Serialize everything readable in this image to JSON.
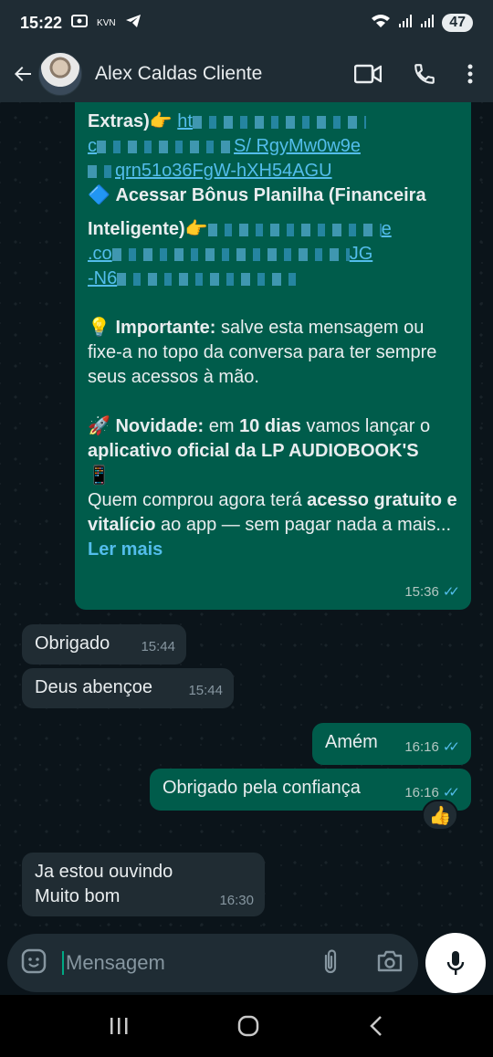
{
  "status_bar": {
    "time": "15:22",
    "kvn": "KVN",
    "battery": "47"
  },
  "header": {
    "contact_name": "Alex Caldas Cliente"
  },
  "messages": {
    "big": {
      "line1_bold": "Extras)👉",
      "line1_link": "ht",
      "line2_link": "c",
      "line2_link_end": "S/ RgyMw0w9e",
      "line3_link": "qrn51o36FgW-hXH54AGU",
      "bonus_icon": "🔷",
      "bonus_bold": "Acessar Bônus Planilha (Financeira",
      "bonus_bold2": "Inteligente)👉",
      "bonus_link_end": "e",
      "link_c": ".co",
      "link_c_end": "JG",
      "link_n": "-N6",
      "important_icon": "💡",
      "important_bold": "Importante:",
      "important_text": " salve esta mensagem ou fixe-a no topo da conversa para ter sempre seus acessos à mão.",
      "news_icon": "🚀",
      "news_bold": "Novidade:",
      "news_text1": " em ",
      "news_bold2": "10 dias",
      "news_text2": " vamos lançar o ",
      "news_bold3": "aplicativo oficial da LP AUDIOBOOK'S",
      "phone_icon": "📱",
      "who_text1": "Quem comprou agora terá ",
      "who_bold": "acesso gratuito e vitalício",
      "who_text2": " ao app — sem pagar nada a mais...",
      "read_more": "Ler mais",
      "time": "15:36"
    },
    "m1": {
      "text": "Obrigado",
      "time": "15:44"
    },
    "m2": {
      "text": "Deus abençoe",
      "time": "15:44"
    },
    "m3": {
      "text": "Amém",
      "time": "16:16"
    },
    "m4": {
      "text": "Obrigado pela confiança",
      "time": "16:16",
      "reaction": "👍"
    },
    "m5": {
      "line1": "Ja estou ouvindo",
      "line2": "Muito bom",
      "time": "16:30"
    }
  },
  "input": {
    "placeholder": "Mensagem"
  },
  "colors": {
    "outgoing": "#005c4b",
    "incoming": "#202c33",
    "accent": "#00a884",
    "link": "#53bdeb"
  }
}
